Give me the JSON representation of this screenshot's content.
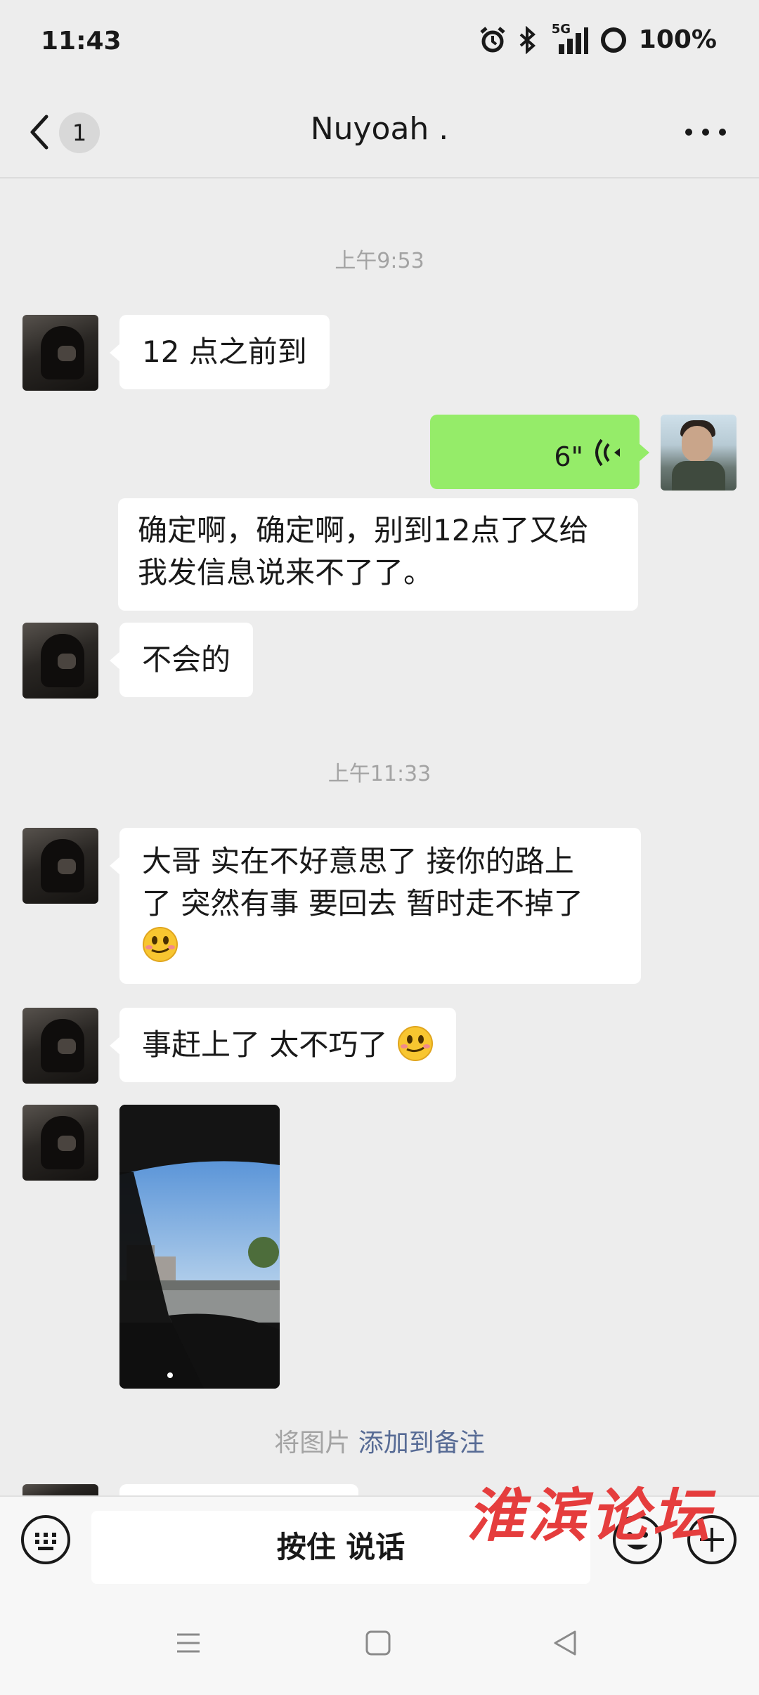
{
  "status_bar": {
    "time": "11:43",
    "network": "5G",
    "battery": "100%",
    "icons": [
      "alarm-icon",
      "bluetooth-icon",
      "signal-icon",
      "battery-icon"
    ]
  },
  "header": {
    "back_icon": "chevron-left-icon",
    "unread_count": "1",
    "title": "Nuyoah .",
    "more_icon": "more-horizontal-icon"
  },
  "messages": {
    "time_1": "上午9:53",
    "m1": "12 点之前到",
    "voice_length": "6\"",
    "m2_line1": "确定啊，确定啊，别到12点了又给",
    "m2_line2": "我发信息说来不了了。",
    "m3": "不会的",
    "time_2": "上午11:33",
    "m4_line1": "大哥 实在不好意思了 接你的路上",
    "m4_line2": "了 突然有事 要回去 暂时走不掉了",
    "m5": "事赶上了 太不巧了",
    "note_prefix": "将图片",
    "note_link": "添加到备注"
  },
  "input_bar": {
    "hold_to_talk": "按住 说话",
    "left_icon": "keyboard-icon",
    "emoji_icon": "emoji-icon",
    "plus_icon": "plus-circle-icon"
  },
  "watermark": "淮滨论坛",
  "colors": {
    "background": "#ededed",
    "self_bubble": "#95ec69",
    "link": "#576b95",
    "watermark": "#e53d3d"
  }
}
